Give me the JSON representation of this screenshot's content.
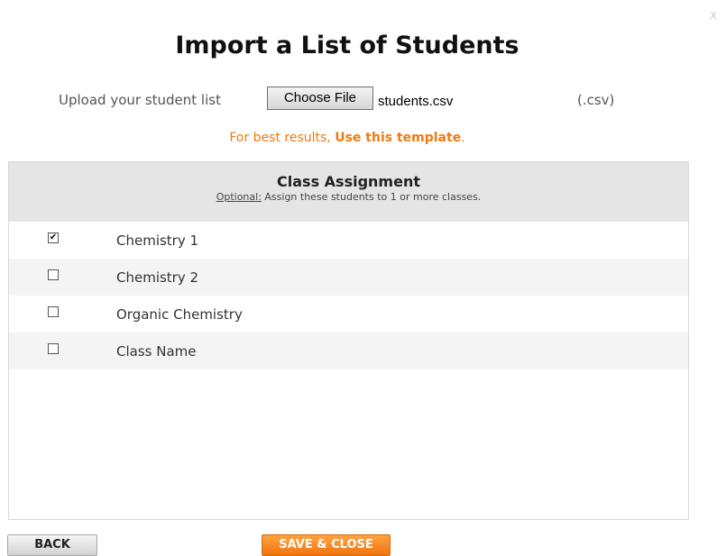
{
  "close_label": "X",
  "title": "Import a List of Students",
  "upload": {
    "label": "Upload your student list",
    "button_label": "Choose File",
    "file_name": "students.csv",
    "extension_hint": "(.csv)"
  },
  "template": {
    "prefix": "For best results, ",
    "link_text": "Use this template",
    "suffix": "."
  },
  "class_assignment": {
    "title": "Class Assignment",
    "optional_label": "Optional:",
    "instructions": " Assign these students to 1 or more classes.",
    "classes": [
      {
        "label": "Chemistry 1",
        "checked": true,
        "mark": "✔"
      },
      {
        "label": "Chemistry 2",
        "checked": false,
        "mark": ""
      },
      {
        "label": "Organic Chemistry",
        "checked": false,
        "mark": ""
      },
      {
        "label": "Class Name",
        "checked": false,
        "mark": ""
      }
    ]
  },
  "buttons": {
    "back_label": "BACK",
    "save_label": "SAVE & CLOSE"
  },
  "colors": {
    "accent": "#ee7a12",
    "header_bg": "#e5e5e5"
  }
}
